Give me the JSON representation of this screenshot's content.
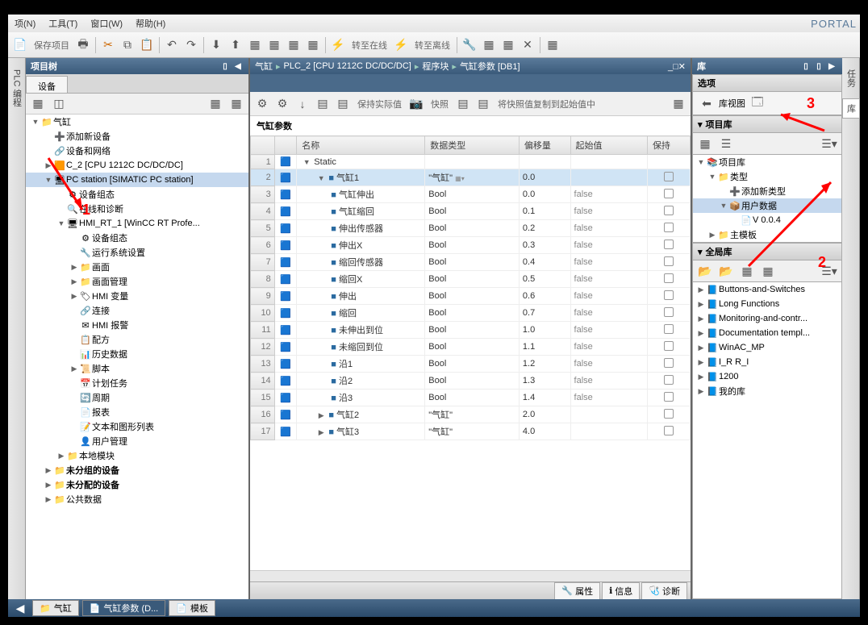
{
  "menus": {
    "project": "项(N)",
    "tools": "工具(T)",
    "window": "窗口(W)",
    "help": "帮助(H)"
  },
  "portal": "PORTAL",
  "toolbar": {
    "save": "保存项目",
    "online": "转至在线",
    "offline": "转至离线"
  },
  "tree": {
    "title": "项目树",
    "tab": "设备",
    "root": "气缸",
    "add_device": "添加新设备",
    "devices_networks": "设备和网络",
    "plc": "C_2 [CPU 1212C DC/DC/DC]",
    "pc_station": "PC station [SIMATIC PC station]",
    "device_config": "设备组态",
    "online_diag": "在线和诊断",
    "hmi": "HMI_RT_1 [WinCC RT Profe...",
    "hmi_device_config": "设备组态",
    "runtime_settings": "运行系统设置",
    "screens": "画面",
    "screen_mgmt": "画面管理",
    "hmi_tags": "HMI 变量",
    "connections": "连接",
    "hmi_alarms": "HMI 报警",
    "recipes": "配方",
    "historical": "历史数据",
    "scripts": "脚本",
    "scheduled": "计划任务",
    "cycles": "周期",
    "reports": "报表",
    "text_graphic": "文本和图形列表",
    "user_admin": "用户管理",
    "local_modules": "本地模块",
    "ungrouped": "未分组的设备",
    "unassigned": "未分配的设备",
    "common": "公共数据"
  },
  "bc": {
    "p1": "气缸",
    "p2": "PLC_2 [CPU 1212C DC/DC/DC]",
    "p3": "程序块",
    "p4": "气缸参数 [DB1]"
  },
  "mtb": {
    "keep_actual": "保持实际值",
    "snapshot": "快照",
    "copy_snapshot": "将快照值复制到起始值中"
  },
  "db": {
    "title": "气缸参数",
    "cols": {
      "name": "名称",
      "dtype": "数据类型",
      "offset": "偏移量",
      "start": "起始值",
      "retain": "保持"
    },
    "rows": [
      {
        "n": 1,
        "lvl": 0,
        "tw": "▼",
        "name": "Static",
        "dtype": "",
        "offset": "",
        "start": "",
        "chk": false
      },
      {
        "n": 2,
        "lvl": 1,
        "tw": "▼",
        "b": true,
        "name": "气缸1",
        "dtype": "\"气缸\"",
        "offset": "0.0",
        "start": "",
        "chk": true,
        "sel": true,
        "dd": true
      },
      {
        "n": 3,
        "lvl": 2,
        "b": true,
        "name": "气缸伸出",
        "dtype": "Bool",
        "offset": "0.0",
        "start": "false",
        "chk": true
      },
      {
        "n": 4,
        "lvl": 2,
        "b": true,
        "name": "气缸缩回",
        "dtype": "Bool",
        "offset": "0.1",
        "start": "false",
        "chk": true
      },
      {
        "n": 5,
        "lvl": 2,
        "b": true,
        "name": "伸出传感器",
        "dtype": "Bool",
        "offset": "0.2",
        "start": "false",
        "chk": true
      },
      {
        "n": 6,
        "lvl": 2,
        "b": true,
        "name": "伸出X",
        "dtype": "Bool",
        "offset": "0.3",
        "start": "false",
        "chk": true
      },
      {
        "n": 7,
        "lvl": 2,
        "b": true,
        "name": "缩回传感器",
        "dtype": "Bool",
        "offset": "0.4",
        "start": "false",
        "chk": true
      },
      {
        "n": 8,
        "lvl": 2,
        "b": true,
        "name": "缩回X",
        "dtype": "Bool",
        "offset": "0.5",
        "start": "false",
        "chk": true
      },
      {
        "n": 9,
        "lvl": 2,
        "b": true,
        "name": "伸出",
        "dtype": "Bool",
        "offset": "0.6",
        "start": "false",
        "chk": true
      },
      {
        "n": 10,
        "lvl": 2,
        "b": true,
        "name": "缩回",
        "dtype": "Bool",
        "offset": "0.7",
        "start": "false",
        "chk": true
      },
      {
        "n": 11,
        "lvl": 2,
        "b": true,
        "name": "未伸出到位",
        "dtype": "Bool",
        "offset": "1.0",
        "start": "false",
        "chk": true
      },
      {
        "n": 12,
        "lvl": 2,
        "b": true,
        "name": "未缩回到位",
        "dtype": "Bool",
        "offset": "1.1",
        "start": "false",
        "chk": true
      },
      {
        "n": 13,
        "lvl": 2,
        "b": true,
        "name": "沿1",
        "dtype": "Bool",
        "offset": "1.2",
        "start": "false",
        "chk": true
      },
      {
        "n": 14,
        "lvl": 2,
        "b": true,
        "name": "沿2",
        "dtype": "Bool",
        "offset": "1.3",
        "start": "false",
        "chk": true
      },
      {
        "n": 15,
        "lvl": 2,
        "b": true,
        "name": "沿3",
        "dtype": "Bool",
        "offset": "1.4",
        "start": "false",
        "chk": true
      },
      {
        "n": 16,
        "lvl": 1,
        "tw": "▶",
        "b": true,
        "name": "气缸2",
        "dtype": "\"气缸\"",
        "offset": "2.0",
        "start": "",
        "chk": true
      },
      {
        "n": 17,
        "lvl": 1,
        "tw": "▶",
        "b": true,
        "name": "气缸3",
        "dtype": "\"气缸\"",
        "offset": "4.0",
        "start": "",
        "chk": true
      }
    ]
  },
  "bottom": {
    "properties": "属性",
    "info": "信息",
    "diag": "诊断"
  },
  "lib": {
    "title": "库",
    "options": "选项",
    "lib_view": "库视图",
    "project_lib": "项目库",
    "project_lib_node": "项目库",
    "types": "类型",
    "add_type": "添加新类型",
    "user_data": "用户数据",
    "version": "V 0.0.4",
    "master": "主模板",
    "global_lib": "全局库",
    "buttons": "Buttons-and-Switches",
    "long_fn": "Long Functions",
    "monitoring": "Monitoring-and-contr...",
    "doc": "Documentation templ...",
    "winac": "WinAC_MP",
    "lrr": "I_R R_I",
    "1200": "1200",
    "mylib": "我的库"
  },
  "vtabs": {
    "plc": "PLC 编程",
    "tasks": "任务",
    "lib": "库"
  },
  "annotations": {
    "a1": "1",
    "a2": "2",
    "a3": "3"
  },
  "status": {
    "project": "气缸",
    "db": "气缸参数 (D...",
    "template": "模板"
  }
}
